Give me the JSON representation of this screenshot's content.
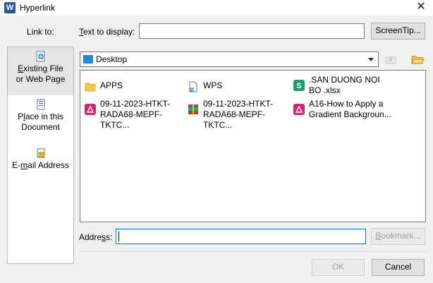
{
  "window": {
    "app_logo": "W",
    "title": "Hyperlink",
    "close_glyph": "✕"
  },
  "link_to": {
    "label": "Link to:",
    "items": [
      {
        "icon": "globe-document-icon",
        "line1": "Existing File",
        "line2": "or Web Page",
        "selected": true
      },
      {
        "icon": "document-page-icon",
        "line1": "Place in this",
        "line2": "Document",
        "selected": false
      },
      {
        "icon": "email-icon",
        "line1": "E-mail Address",
        "line2": "",
        "selected": false
      }
    ]
  },
  "text_to_display": {
    "label": "Text to display:",
    "value": ""
  },
  "screentip_button": "ScreenTip...",
  "look_in": {
    "value": "Desktop",
    "icon": "desktop-icon"
  },
  "files": [
    {
      "name": "APPS",
      "icon": "folder-icon",
      "color": "#f7c948"
    },
    {
      "name": "WPS",
      "icon": "shortcut-file-icon",
      "color": "#6b7a8f"
    },
    {
      "name": ".SAN DUONG NOI BO .xlsx",
      "icon": "spreadsheet-icon",
      "color": "#1e9e6a"
    },
    {
      "name": "09-11-2023-HTKT-RADA68-MEPF-TKTC...",
      "icon": "pdf-icon",
      "color": "#d6246e"
    },
    {
      "name": "09-11-2023-HTKT-RADA68-MEPF-TKTC...",
      "icon": "archive-icon",
      "color": "#8e44ad"
    },
    {
      "name": "A16-How to Apply a Gradient Backgroun...",
      "icon": "pdf-icon",
      "color": "#d6246e"
    }
  ],
  "address": {
    "label": "Address:",
    "value": ""
  },
  "bookmark_button": "Bookmark...",
  "ok_button": "OK",
  "cancel_button": "Cancel",
  "colors": {
    "accent": "#0078d7",
    "dialog_bg": "#f0f0f0"
  }
}
